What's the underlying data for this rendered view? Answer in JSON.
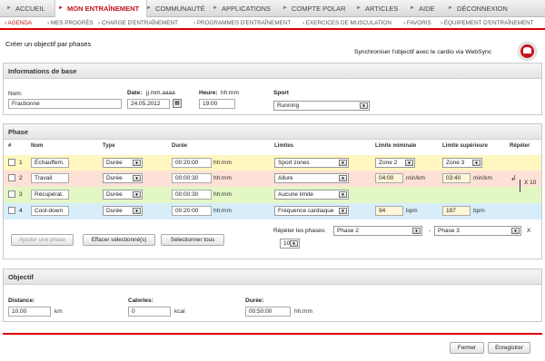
{
  "nav": {
    "items": [
      "ACCUEIL",
      "MON ENTRAÎNEMENT",
      "COMMUNAUTÉ",
      "APPLICATIONS",
      "COMPTE POLAR",
      "ARTICLES",
      "AIDE",
      "DÉCONNEXION"
    ]
  },
  "subnav": {
    "items": [
      "AGENDA",
      "MES PROGRÈS",
      "CHARGE D'ENTRAÎNEMENT",
      "PROGRAMMES D'ENTRAÎNEMENT",
      "EXERCICES DE MUSCULATION",
      "FAVORIS",
      "ÉQUIPEMENT D'ENTRAÎNEMENT"
    ]
  },
  "page": {
    "title": "Créer un objectif par phases",
    "sync_label": "Synchroniser l'objectif avec le cardio via WebSync"
  },
  "basic": {
    "title": "Informations de base",
    "name_label": "Nom:",
    "name_value": "Fractionné",
    "date_label": "Date:",
    "date_format": "jj.mm.aaaa",
    "date_value": "24.05.2012",
    "time_label": "Heure:",
    "time_format": "hh:mm",
    "time_value": "19:00",
    "sport_label": "Sport",
    "sport_value": "Running"
  },
  "phase": {
    "title": "Phase",
    "columns": {
      "num": "#",
      "name": "Nom",
      "type": "Type",
      "duration": "Durée",
      "limits": "Limites",
      "min": "Limite miminale",
      "max": "Limite supérieure",
      "repeat": "Répéter"
    },
    "rows": [
      {
        "num": "1",
        "name": "Échauffem.",
        "type": "Durée",
        "duration": "00:20:00",
        "dur_unit": "hh:mm",
        "limit": "Sport zones",
        "min": "Zone 2",
        "min_unit": "",
        "max": "Zone 3",
        "max_unit": "",
        "color": "#fff6c0"
      },
      {
        "num": "2",
        "name": "Travail",
        "type": "Durée",
        "duration": "00:00:30",
        "dur_unit": "hh:mm",
        "limit": "Allure",
        "min": "04:00",
        "min_unit": "min/km",
        "max": "03:40",
        "max_unit": "min/km",
        "color": "#fde1d6"
      },
      {
        "num": "3",
        "name": "Récupérat.",
        "type": "Durée",
        "duration": "00:00:30",
        "dur_unit": "hh:mm",
        "limit": "Aucune limite",
        "min": "",
        "min_unit": "",
        "max": "",
        "max_unit": "",
        "color": "#e3f7c5"
      },
      {
        "num": "4",
        "name": "Cool-down",
        "type": "Durée",
        "duration": "00:20:00",
        "dur_unit": "hh:mm",
        "limit": "Fréquence cardiaque",
        "min": "94",
        "min_unit": "bpm",
        "max": "187",
        "max_unit": "bpm",
        "color": "#d7eefa"
      }
    ],
    "repeat_mark": "X 10",
    "add_btn": "Ajouter une phase",
    "delete_btn": "Effacer sélectionné(s)",
    "select_all_btn": "Sélectionner tous",
    "repeat_label": "Répéter les phases:",
    "repeat_from": "Phase 2",
    "repeat_dash": "-",
    "repeat_to": "Phase 3",
    "repeat_x": "X",
    "repeat_count": "10"
  },
  "objective": {
    "title": "Objectif",
    "distance_label": "Distance:",
    "distance_value": "10.00",
    "distance_unit": "km",
    "calories_label": "Calories:",
    "calories_value": "0",
    "calories_unit": "kcal",
    "duration_label": "Durée:",
    "duration_value": "00:50:00",
    "duration_unit": "hh:mm"
  },
  "footer": {
    "close": "Fermer",
    "save": "Enregistrer"
  },
  "colors": {
    "accent": "#c0111b"
  }
}
